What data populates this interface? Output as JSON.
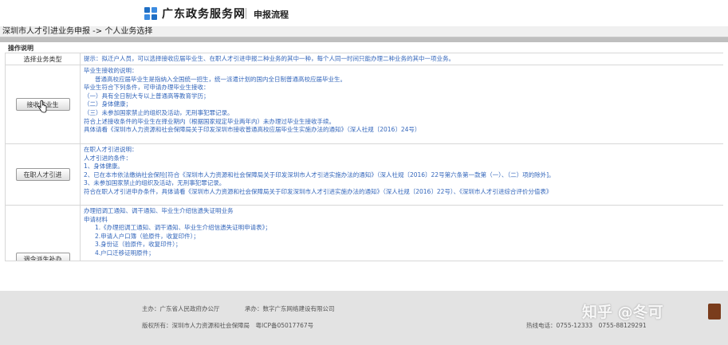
{
  "header": {
    "logo_text": "广东政务服务网",
    "subtitle": "申报流程"
  },
  "breadcrumb": "深圳市人才引进业务申报 -> 个人业务选择",
  "ops_title": "操作说明",
  "table": {
    "header_left": "选择业务类型",
    "header_right": "提示：拟迁户人员，可以选择接收应届毕业生、在职人才引进申报二种业务的其中一种，每个人同一时间只能办理二种业务的其中一项业务。",
    "rows": [
      {
        "button": "接收毕业生",
        "lines": [
          "毕业生接收的说明：",
          "普通高校应届毕业生是指纳入全国统一招生，统一派遣计划的国内全日制普通高校应届毕业生。",
          "毕业生符合下列条件，可申请办理毕业生接收：",
          "（一）具有全日制大专以上普通高等教育学历；",
          "（二）身体健康；",
          "（三）未参加国家禁止的组织及活动，无刑事犯罪记录。",
          "符合上述接收条件的毕业生在择业期内（根据国家规定毕业两年内）未办理过毕业生接收手续。",
          "具体请看《深圳市人力资源和社会保障局关于印发深圳市接收普通高校应届毕业生实施办法的通知》（深人社规〔2016〕24号）"
        ]
      },
      {
        "button": "在职人才引进",
        "lines": [
          "在职人才引进说明：",
          "人才引进的条件：",
          "1、身体健康。",
          "2、已在本市依法缴纳社会保险[符合《深圳市人力资源和社会保障局关于印发深圳市人才引进实施办法的通知》（深人社规〔2016〕22号第六条第一款第（一）、（二）项的除外]。",
          "3、未参加国家禁止的组织及活动，无刑事犯罪记录。",
          "符合在职人才引进申办条件，具体请看《深圳市人力资源和社会保障局关于印发深圳市人才引进实施办法的通知》（深人社规〔2016〕22号）、《深圳市人才引进综合评价分值表》"
        ]
      },
      {
        "button": "调令派生补办",
        "lines": [
          "办理招调工通知、调干通知、毕业生介绍信遗失证明业务",
          "申请材料",
          "1.《办理招调工通知、调干通知、毕业生介绍信遗失证明申请表》；",
          "2.申请人户口簿（验原件，收复印件）；",
          "3.身份证（验原件，收复印件）；",
          "4.户口迁移证明原件；"
        ]
      }
    ]
  },
  "footer": {
    "sponsor": "主办：广东省人民政府办公厅",
    "operator": "承办：数字广东网络建设有限公司",
    "copyright": "版权所有：深圳市人力资源和社会保障局　粤ICP备05017767号",
    "hotline": "热线电话：0755-12333　0755-88129291",
    "watermark": "知乎 @冬可"
  },
  "colors": {
    "link_blue": "#3366bb",
    "band_gray": "#bfbfbf",
    "footer_gray": "#e3e3e3",
    "logo_blue": "#1f6fc5"
  }
}
